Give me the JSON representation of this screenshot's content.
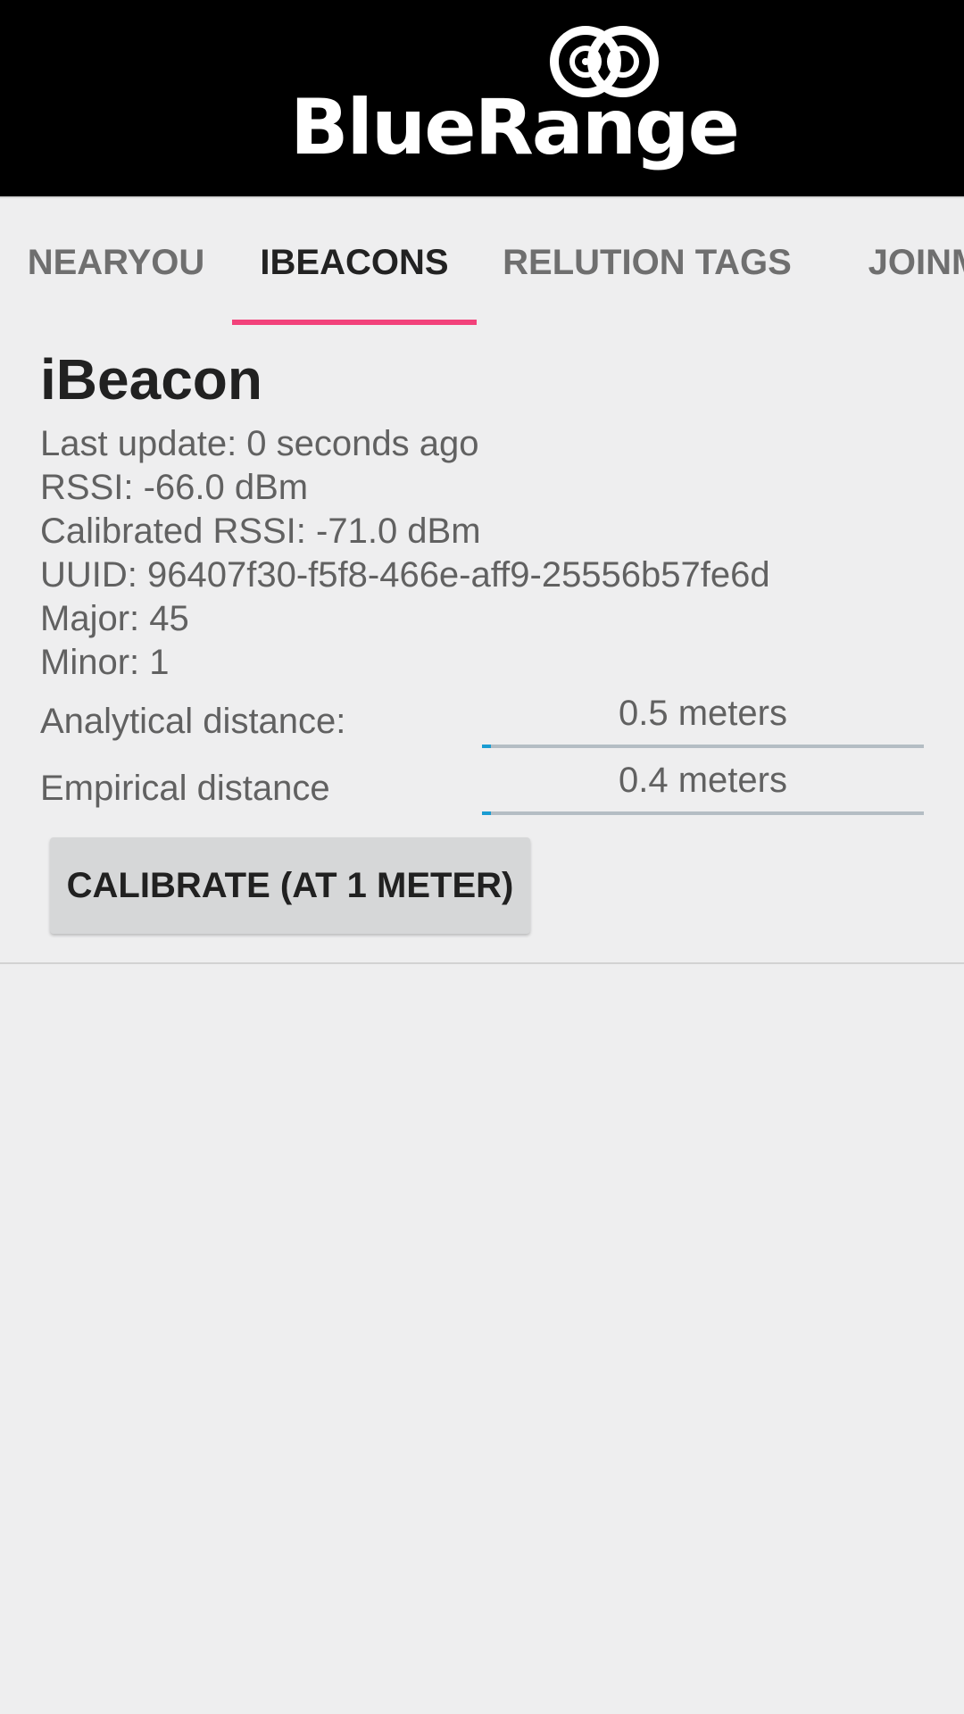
{
  "app": {
    "brand": "BlueRange"
  },
  "tabs": [
    {
      "label": "NEARYOU",
      "active": false
    },
    {
      "label": "IBEACONS",
      "active": true
    },
    {
      "label": "RELUTION TAGS",
      "active": false
    },
    {
      "label": "JOINM",
      "active": false
    }
  ],
  "beacon": {
    "title": "iBeacon",
    "last_update": "Last update: 0 seconds ago",
    "rssi": "RSSI: -66.0 dBm",
    "calibrated_rssi": "Calibrated RSSI: -71.0 dBm",
    "uuid": "UUID: 96407f30-f5f8-466e-aff9-25556b57fe6d",
    "major": "Major: 45",
    "minor": "Minor: 1",
    "analytical": {
      "label": "Analytical distance:",
      "value": "0.5 meters",
      "bar_fraction": 0.02
    },
    "empirical": {
      "label": "Empirical distance",
      "value": "0.4 meters",
      "bar_fraction": 0.02
    },
    "calibrate_label": "CALIBRATE (AT 1 METER)"
  },
  "colors": {
    "header_bg": "#000000",
    "tab_indicator": "#f2427b",
    "progress_fill": "#1a9cd2",
    "progress_track": "#b4bdc4",
    "page_bg": "#eeeeef"
  },
  "icons": {
    "brand_logo": "bluerange-logo-icon"
  }
}
